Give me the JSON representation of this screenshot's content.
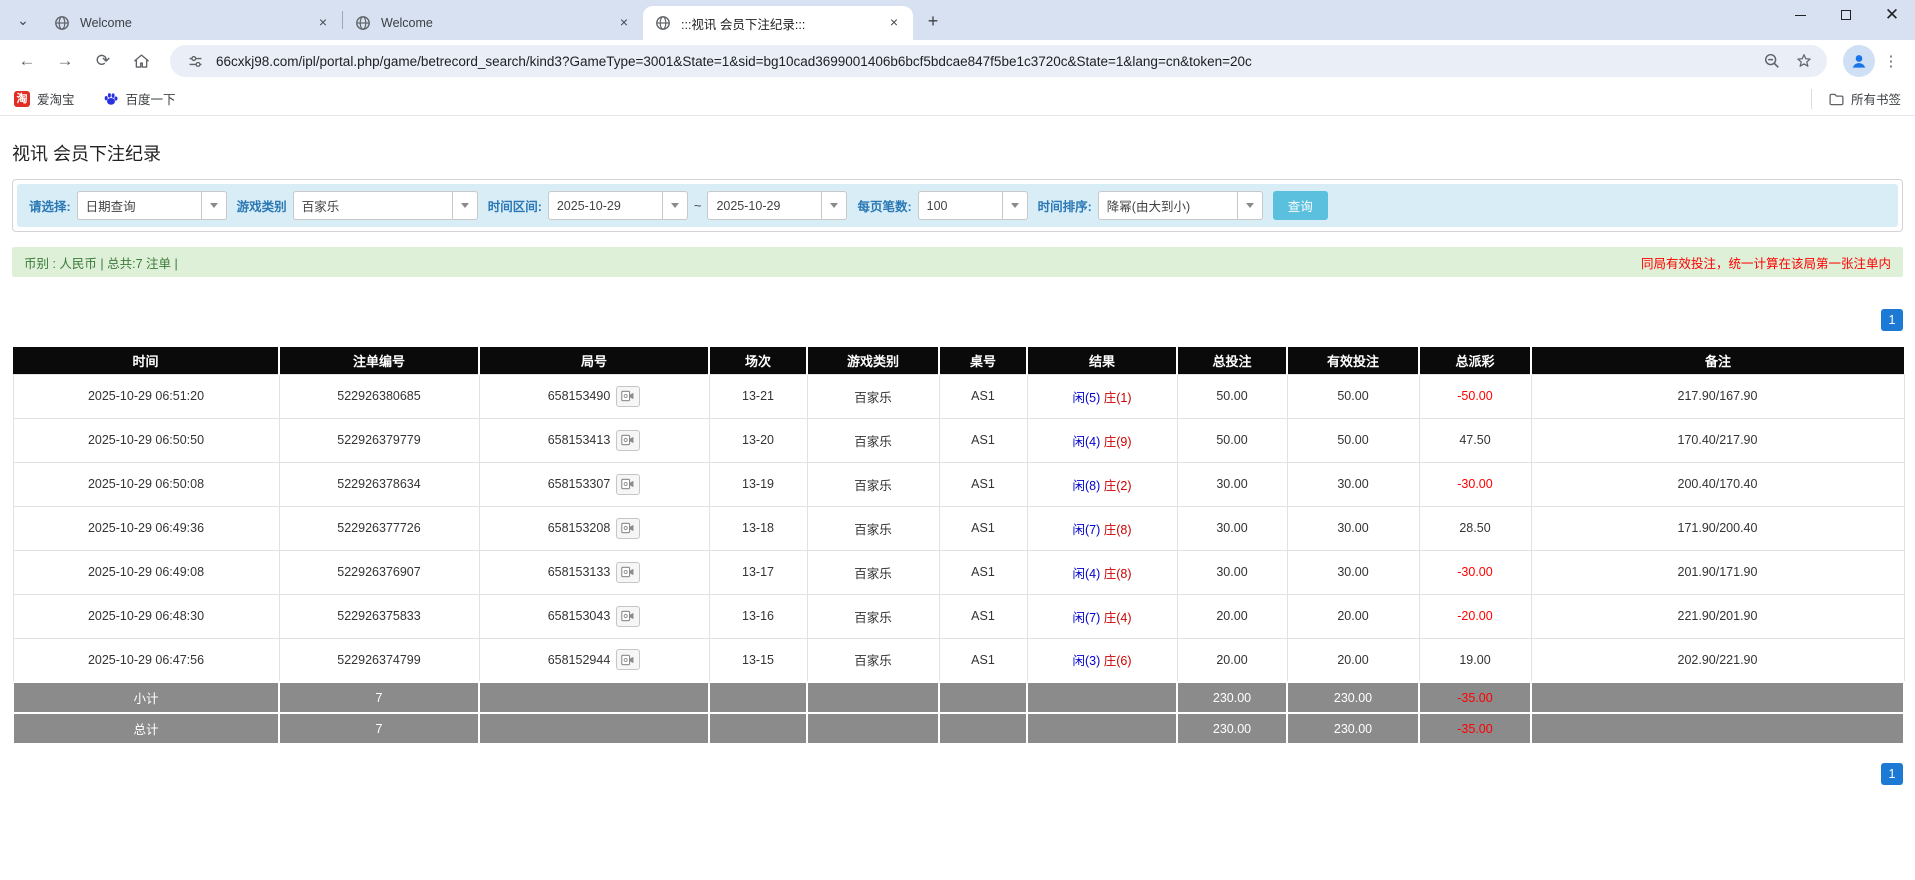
{
  "browser": {
    "tabs": [
      {
        "title": "Welcome"
      },
      {
        "title": "Welcome"
      },
      {
        "title": ":::视讯 会员下注纪录:::"
      }
    ],
    "url": "66cxkj98.com/ipl/portal.php/game/betrecord_search/kind3?GameType=3001&State=1&sid=bg10cad3699001406b6bcf5bdcae847f5be1c3720c&State=1&lang=cn&token=20c",
    "bookmarks": [
      {
        "label": "爱淘宝"
      },
      {
        "label": "百度一下"
      }
    ],
    "all_bookmarks_label": "所有书签",
    "taobao_glyph": "淘"
  },
  "icons": {
    "tab_search_chevron": "⌄",
    "tab_close": "×",
    "new_tab": "+",
    "back": "←",
    "forward": "→",
    "reload": "⟳",
    "menu": "⋮",
    "window_close": "✕"
  },
  "colors": {
    "accent_blue": "#1c7ad4",
    "link_blue": "#0066cc",
    "player_blue": "#0000cc",
    "banker_red": "#cc0000",
    "negative_red": "#ff0000",
    "button_blue": "#5bc0de",
    "filter_bg": "#d9edf7",
    "summary_bg": "#dff0d8",
    "table_header_bg": "#0a0a0a",
    "subtotal_bg": "#8b8b8b"
  },
  "page": {
    "title": "视讯 会员下注纪录",
    "filters": {
      "select_label": "请选择:",
      "select_value": "日期查询",
      "game_type_label": "游戏类别",
      "game_type_value": "百家乐",
      "date_range_label": "时间区间:",
      "date_from": "2025-10-29",
      "tilde": "~",
      "date_to": "2025-10-29",
      "page_size_label": "每页笔数:",
      "page_size_value": "100",
      "sort_label": "时间排序:",
      "sort_value": "降幂(由大到小)",
      "search_button": "查询"
    },
    "summary_bar": {
      "left": "币别 : 人民币 | 总共:7 注单 |",
      "right": "同局有效投注，统一计算在该局第一张注单内"
    },
    "pagination": "1",
    "table": {
      "headers": [
        "时间",
        "注单编号",
        "局号",
        "场次",
        "游戏类别",
        "桌号",
        "结果",
        "总投注",
        "有效投注",
        "总派彩",
        "备注"
      ],
      "rows": [
        {
          "time": "2025-10-29 06:51:20",
          "bet_id": "522926380685",
          "round_id": "658153490",
          "session": "13-21",
          "game": "百家乐",
          "table_no": "AS1",
          "result_player": "闲(5)",
          "result_banker": "庄(1)",
          "total_bet": "50.00",
          "valid_bet": "50.00",
          "payout": "-50.00",
          "remark": "217.90/167.90"
        },
        {
          "time": "2025-10-29 06:50:50",
          "bet_id": "522926379779",
          "round_id": "658153413",
          "session": "13-20",
          "game": "百家乐",
          "table_no": "AS1",
          "result_player": "闲(4)",
          "result_banker": "庄(9)",
          "total_bet": "50.00",
          "valid_bet": "50.00",
          "payout": "47.50",
          "remark": "170.40/217.90"
        },
        {
          "time": "2025-10-29 06:50:08",
          "bet_id": "522926378634",
          "round_id": "658153307",
          "session": "13-19",
          "game": "百家乐",
          "table_no": "AS1",
          "result_player": "闲(8)",
          "result_banker": "庄(2)",
          "total_bet": "30.00",
          "valid_bet": "30.00",
          "payout": "-30.00",
          "remark": "200.40/170.40"
        },
        {
          "time": "2025-10-29 06:49:36",
          "bet_id": "522926377726",
          "round_id": "658153208",
          "session": "13-18",
          "game": "百家乐",
          "table_no": "AS1",
          "result_player": "闲(7)",
          "result_banker": "庄(8)",
          "total_bet": "30.00",
          "valid_bet": "30.00",
          "payout": "28.50",
          "remark": "171.90/200.40"
        },
        {
          "time": "2025-10-29 06:49:08",
          "bet_id": "522926376907",
          "round_id": "658153133",
          "session": "13-17",
          "game": "百家乐",
          "table_no": "AS1",
          "result_player": "闲(4)",
          "result_banker": "庄(8)",
          "total_bet": "30.00",
          "valid_bet": "30.00",
          "payout": "-30.00",
          "remark": "201.90/171.90"
        },
        {
          "time": "2025-10-29 06:48:30",
          "bet_id": "522926375833",
          "round_id": "658153043",
          "session": "13-16",
          "game": "百家乐",
          "table_no": "AS1",
          "result_player": "闲(7)",
          "result_banker": "庄(4)",
          "total_bet": "20.00",
          "valid_bet": "20.00",
          "payout": "-20.00",
          "remark": "221.90/201.90"
        },
        {
          "time": "2025-10-29 06:47:56",
          "bet_id": "522926374799",
          "round_id": "658152944",
          "session": "13-15",
          "game": "百家乐",
          "table_no": "AS1",
          "result_player": "闲(3)",
          "result_banker": "庄(6)",
          "total_bet": "20.00",
          "valid_bet": "20.00",
          "payout": "19.00",
          "remark": "202.90/221.90"
        }
      ],
      "subtotal": {
        "label": "小计",
        "count": "7",
        "total_bet": "230.00",
        "valid_bet": "230.00",
        "payout": "-35.00"
      },
      "total": {
        "label": "总计",
        "count": "7",
        "total_bet": "230.00",
        "valid_bet": "230.00",
        "payout": "-35.00"
      }
    }
  }
}
